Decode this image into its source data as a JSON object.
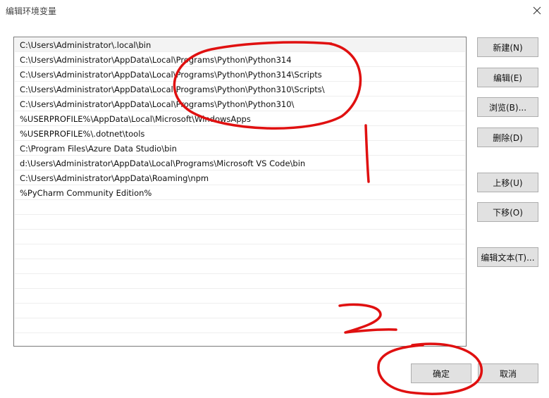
{
  "window": {
    "title": "编辑环境变量"
  },
  "list": {
    "items": [
      "C:\\Users\\Administrator\\.local\\bin",
      "C:\\Users\\Administrator\\AppData\\Local\\Programs\\Python\\Python314",
      "C:\\Users\\Administrator\\AppData\\Local\\Programs\\Python\\Python314\\Scripts",
      "C:\\Users\\Administrator\\AppData\\Local\\Programs\\Python\\Python310\\Scripts\\",
      "C:\\Users\\Administrator\\AppData\\Local\\Programs\\Python\\Python310\\",
      "%USERPROFILE%\\AppData\\Local\\Microsoft\\WindowsApps",
      "%USERPROFILE%\\.dotnet\\tools",
      "C:\\Program Files\\Azure Data Studio\\bin",
      "d:\\Users\\Administrator\\AppData\\Local\\Programs\\Microsoft VS Code\\bin",
      "C:\\Users\\Administrator\\AppData\\Roaming\\npm",
      "%PyCharm Community Edition%"
    ]
  },
  "buttons": {
    "new": "新建(N)",
    "edit": "编辑(E)",
    "browse": "浏览(B)...",
    "delete": "删除(D)",
    "move_up": "上移(U)",
    "move_down": "下移(O)",
    "edit_text": "编辑文本(T)...",
    "ok": "确定",
    "cancel": "取消"
  },
  "colors": {
    "annotation": "#e01010",
    "button_face": "#e1e1e1",
    "button_border": "#adadad",
    "list_border": "#7a7a7a"
  }
}
